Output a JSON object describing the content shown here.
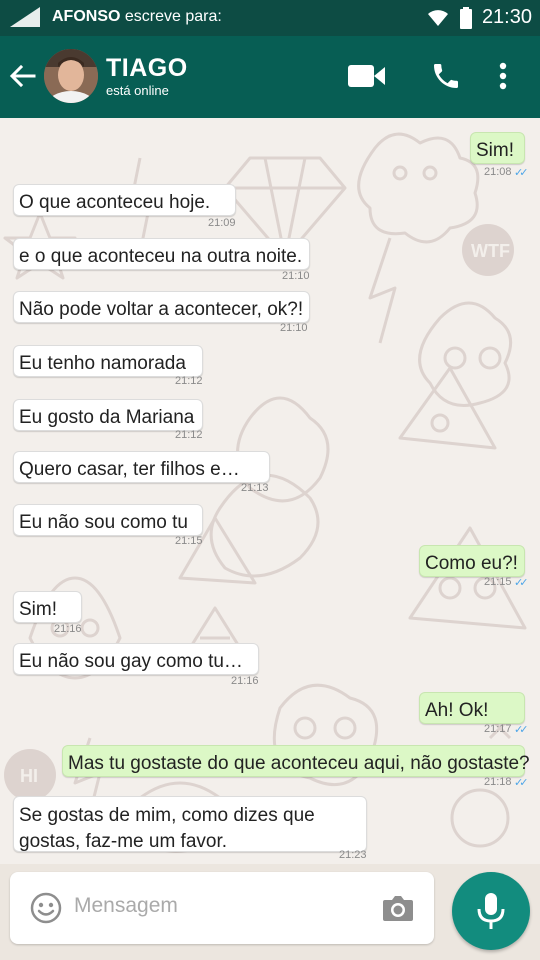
{
  "status_bar": {
    "sender": "AFONSO",
    "label": "escreve para:",
    "time": "21:30"
  },
  "header": {
    "name": "TIAGO",
    "status": "está online"
  },
  "messages": [
    {
      "dir": "out",
      "text": "Sim!",
      "time": "21:08",
      "read": true
    },
    {
      "dir": "in",
      "text": "O que aconteceu hoje.",
      "time": "21:09"
    },
    {
      "dir": "in",
      "text": "e o que aconteceu na outra noite.",
      "time": "21:10"
    },
    {
      "dir": "in",
      "text": "Não pode voltar a acontecer, ok?!",
      "time": "21:10"
    },
    {
      "dir": "in",
      "text": "Eu tenho namorada",
      "time": "21:12"
    },
    {
      "dir": "in",
      "text": "Eu gosto da Mariana",
      "time": "21:12"
    },
    {
      "dir": "in",
      "text": "Quero casar, ter filhos e…",
      "time": "21:13"
    },
    {
      "dir": "in",
      "text": "Eu não sou como tu",
      "time": "21:15"
    },
    {
      "dir": "out",
      "text": "Como eu?!",
      "time": "21:15",
      "read": true
    },
    {
      "dir": "in",
      "text": "Sim!",
      "time": "21:16"
    },
    {
      "dir": "in",
      "text": "Eu não sou gay como tu…",
      "time": "21:16"
    },
    {
      "dir": "out",
      "text": "Ah! Ok!",
      "time": "21:17",
      "read": true
    },
    {
      "dir": "out",
      "text": "Mas tu gostaste do que aconteceu aqui, não gostaste?",
      "time": "21:18",
      "read": true
    },
    {
      "dir": "in",
      "text": "Se gostas de mim, como dizes que gostas, faz-me um favor.",
      "time": "21:23"
    }
  ],
  "composer": {
    "placeholder": "Mensagem"
  },
  "wallpaper": {
    "text": [
      "WTF",
      "HI"
    ]
  },
  "colors": {
    "header": "#075e54",
    "status_bar": "#0d4c44",
    "outgoing": "#dcf8c6",
    "incoming": "#ffffff",
    "fab": "#128c7e",
    "read_tick": "#4fa6e8"
  },
  "icons": [
    "signal-icon",
    "wifi-icon",
    "battery-icon",
    "back-arrow-icon",
    "video-call-icon",
    "phone-icon",
    "more-vert-icon",
    "emoji-icon",
    "camera-icon",
    "mic-icon"
  ]
}
